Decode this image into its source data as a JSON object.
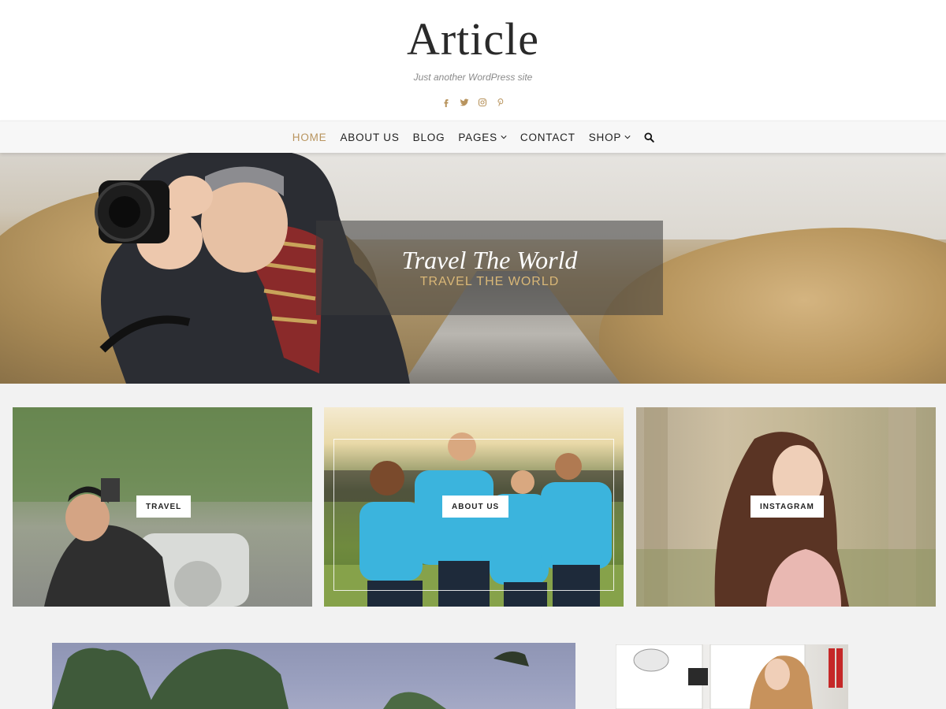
{
  "site": {
    "title": "Article",
    "tagline": "Just another WordPress site"
  },
  "social": [
    {
      "icon": "facebook-icon"
    },
    {
      "icon": "twitter-icon"
    },
    {
      "icon": "instagram-icon"
    },
    {
      "icon": "pinterest-icon"
    }
  ],
  "nav": {
    "items": [
      {
        "label": "HOME",
        "active": true,
        "dropdown": false
      },
      {
        "label": "ABOUT US",
        "active": false,
        "dropdown": false
      },
      {
        "label": "BLOG",
        "active": false,
        "dropdown": false
      },
      {
        "label": "PAGES",
        "active": false,
        "dropdown": true
      },
      {
        "label": "CONTACT",
        "active": false,
        "dropdown": false
      },
      {
        "label": "SHOP",
        "active": false,
        "dropdown": true
      }
    ],
    "search_icon": "search-icon"
  },
  "hero": {
    "title": "Travel The World",
    "subtitle": "TRAVEL THE WORLD"
  },
  "promos": [
    {
      "label": "TRAVEL"
    },
    {
      "label": "ABOUT US"
    },
    {
      "label": "INSTAGRAM"
    }
  ],
  "colors": {
    "accent": "#b8945e",
    "text": "#222222",
    "background": "#f2f2f2"
  }
}
